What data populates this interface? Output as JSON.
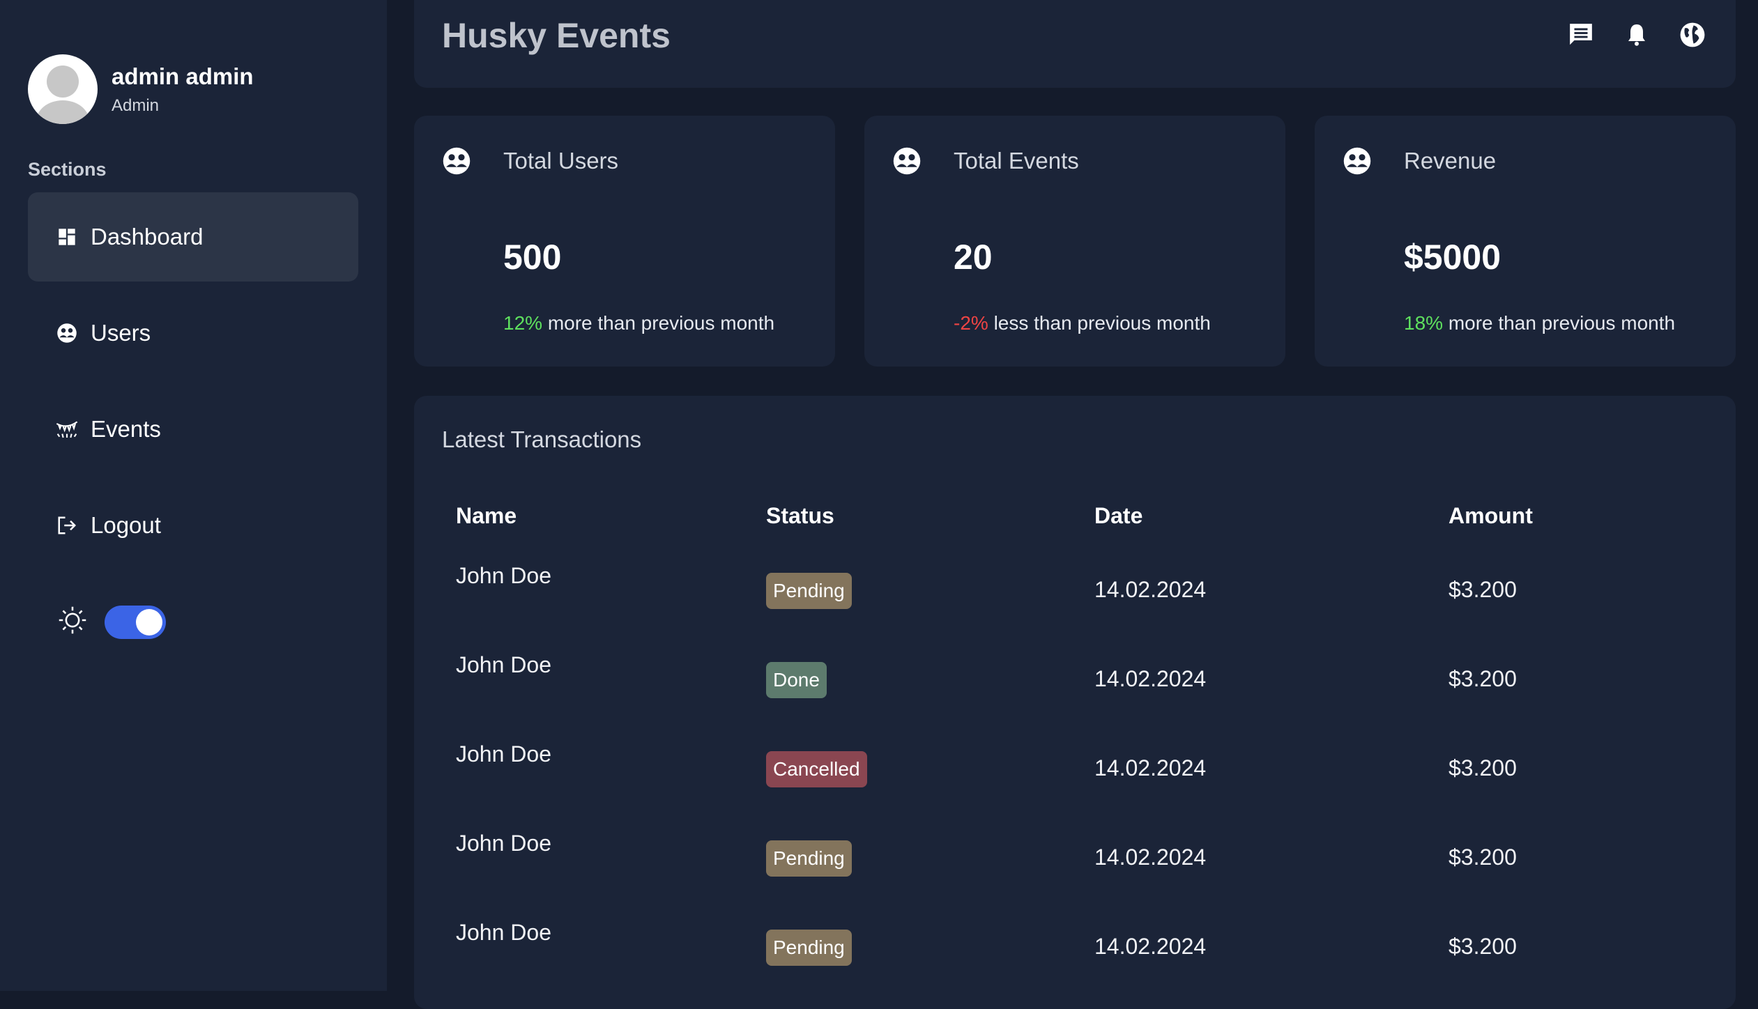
{
  "app": {
    "title": "Husky Events"
  },
  "profile": {
    "name": "admin admin",
    "role": "Admin"
  },
  "sidebar": {
    "section_label": "Sections",
    "items": [
      {
        "label": "Dashboard",
        "icon": "dashboard-icon",
        "active": true
      },
      {
        "label": "Users",
        "icon": "users-icon",
        "active": false
      },
      {
        "label": "Events",
        "icon": "events-icon",
        "active": false
      },
      {
        "label": "Logout",
        "icon": "logout-icon",
        "active": false
      }
    ],
    "theme_toggle": {
      "icon": "sun-icon",
      "on": true
    }
  },
  "header": {
    "icons": [
      "chat-icon",
      "bell-icon",
      "globe-icon"
    ]
  },
  "stats": [
    {
      "label": "Total Users",
      "value": "500",
      "change": "12%",
      "change_text": " more than previous month",
      "trend": "up"
    },
    {
      "label": "Total Events",
      "value": "20",
      "change": "-2%",
      "change_text": " less than previous month",
      "trend": "down"
    },
    {
      "label": "Revenue",
      "value": "$5000",
      "change": "18%",
      "change_text": " more than previous month",
      "trend": "up"
    }
  ],
  "transactions": {
    "title": "Latest Transactions",
    "columns": [
      "Name",
      "Status",
      "Date",
      "Amount"
    ],
    "rows": [
      {
        "name": "John Doe",
        "status": "Pending",
        "date": "14.02.2024",
        "amount": "$3.200"
      },
      {
        "name": "John Doe",
        "status": "Done",
        "date": "14.02.2024",
        "amount": "$3.200"
      },
      {
        "name": "John Doe",
        "status": "Cancelled",
        "date": "14.02.2024",
        "amount": "$3.200"
      },
      {
        "name": "John Doe",
        "status": "Pending",
        "date": "14.02.2024",
        "amount": "$3.200"
      },
      {
        "name": "John Doe",
        "status": "Pending",
        "date": "14.02.2024",
        "amount": "$3.200"
      }
    ]
  },
  "colors": {
    "background": "#141b2b",
    "panel": "#1b2438",
    "accent": "#3b64e6",
    "positive": "#5ee05e",
    "negative": "#ee4444",
    "pending": "#83745c",
    "done": "#5d7b6d",
    "cancelled": "#8a4651"
  }
}
